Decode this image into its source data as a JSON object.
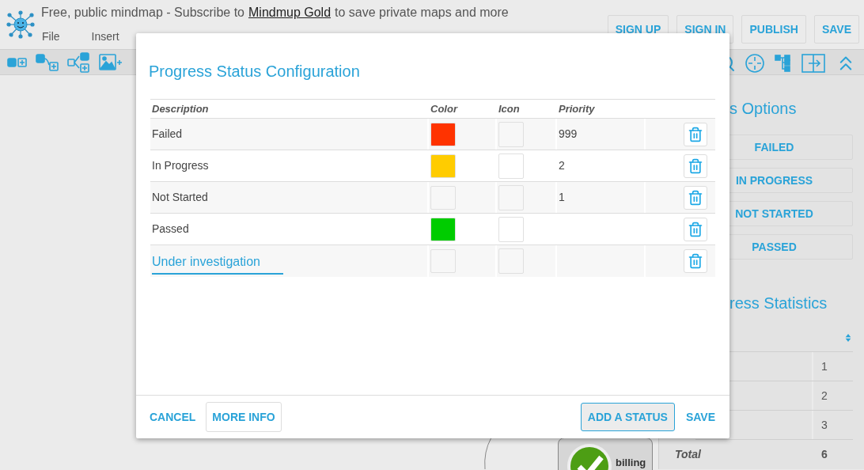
{
  "header": {
    "notice_before": "Free, public mindmap - Subscribe to",
    "notice_link": "Mindmup Gold",
    "notice_after": "to save private maps and more",
    "menu": [
      "File",
      "Insert"
    ],
    "buttons": [
      "SIGN UP",
      "SIGN IN",
      "PUBLISH",
      "SAVE"
    ]
  },
  "side_panel": {
    "options_title": "s Options",
    "options": [
      "FAILED",
      "IN PROGRESS",
      "NOT STARTED",
      "PASSED"
    ],
    "stats_title": "ress Statistics",
    "stats_values": [
      "1",
      "2",
      "3"
    ],
    "total_label": "Total",
    "total_value": "6"
  },
  "node": {
    "label": "billing"
  },
  "dialog": {
    "title": "Progress Status Configuration",
    "columns": [
      "Description",
      "Color",
      "Icon",
      "Priority"
    ],
    "rows": [
      {
        "kind": "text",
        "description": "Failed",
        "color": "#ff3300",
        "priority": "999"
      },
      {
        "kind": "text",
        "description": "In Progress",
        "color": "#ffcc00",
        "priority": "2"
      },
      {
        "kind": "text",
        "description": "Not Started",
        "priority": "1"
      },
      {
        "kind": "text",
        "description": "Passed",
        "color": "#00cc00"
      },
      {
        "kind": "field",
        "description": "Under investigation"
      }
    ],
    "footer_left": [
      "CANCEL",
      "MORE INFO"
    ],
    "footer_right": [
      "ADD A STATUS",
      "SAVE"
    ]
  }
}
